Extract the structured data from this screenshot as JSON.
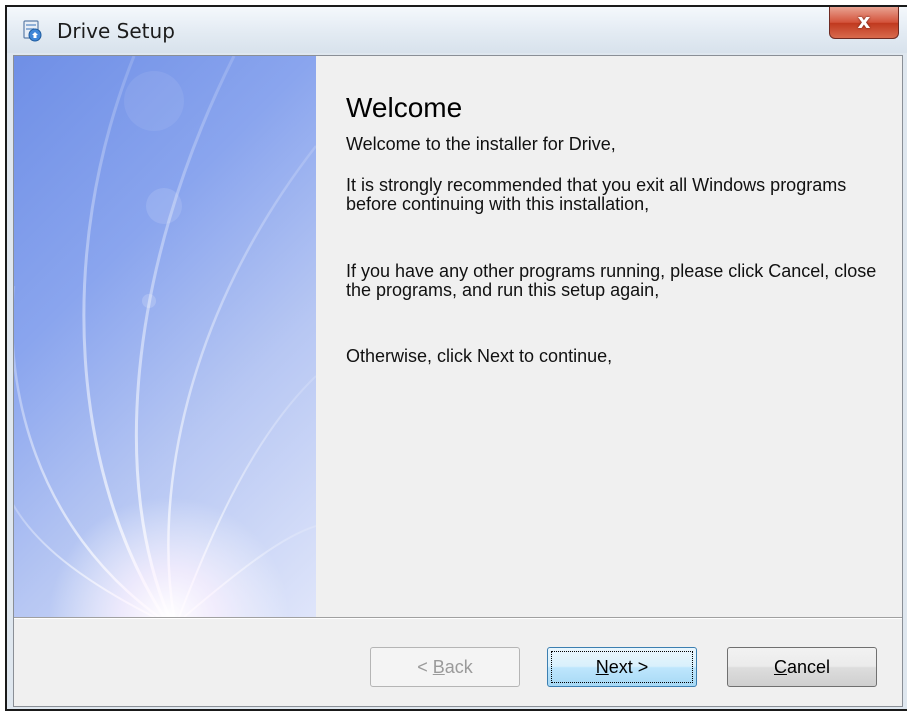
{
  "window": {
    "title": "Drive Setup",
    "close_glyph": "x",
    "icon": "setup-app-icon",
    "accent_close": "#c8432a",
    "title_bg": "#e3ebf3"
  },
  "welcome": {
    "heading": "Welcome",
    "paragraph_1": "Welcome to the installer for Drive,",
    "paragraph_2": "It is strongly recommended that you exit all Windows programs before continuing with this installation,",
    "paragraph_3": "If you have any other programs running, please click Cancel, close the programs, and run this setup again,",
    "paragraph_4": "Otherwise, click Next to continue,"
  },
  "side_panel": {
    "image": "blue-light-ray-banner",
    "colors": [
      "#6f8fe6",
      "#dfe5fa"
    ]
  },
  "buttons": {
    "back": {
      "label": "< Back",
      "mnemonic": "B",
      "enabled": false
    },
    "next": {
      "label": "Next >",
      "mnemonic": "N",
      "enabled": true,
      "focused": true
    },
    "cancel": {
      "label": "Cancel",
      "mnemonic": "C",
      "enabled": true
    }
  }
}
